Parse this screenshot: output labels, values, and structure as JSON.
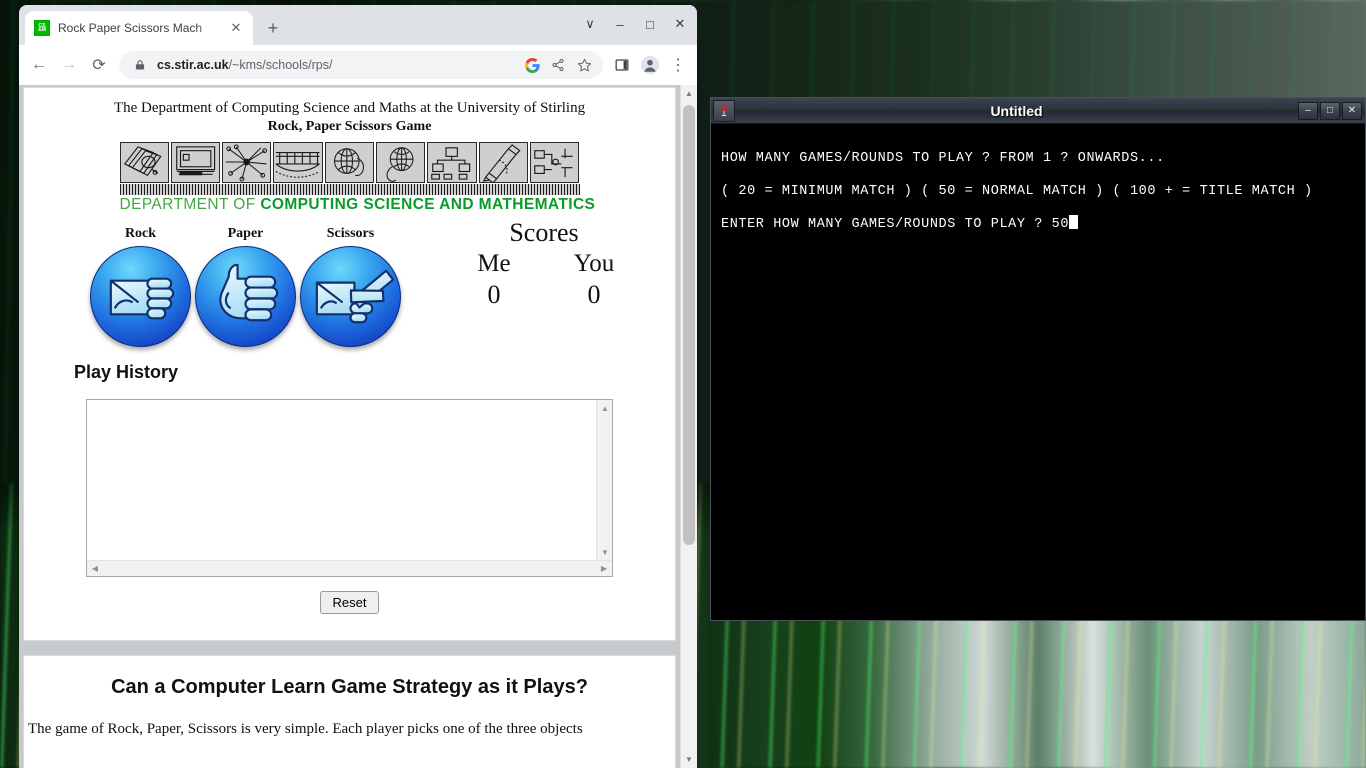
{
  "browser": {
    "tab": {
      "title": "Rock Paper Scissors Mach",
      "favicon_line1": "CS",
      "favicon_line2": "&M",
      "close_label": "✕",
      "favicon_icon": "cs-and-m-favicon"
    },
    "new_tab_label": "+",
    "window_controls": {
      "tab_search": "∨",
      "minimize": "–",
      "maximize": "□",
      "close": "✕"
    },
    "toolbar": {
      "back": "←",
      "forward": "→",
      "reload": "⟳",
      "lock_icon": "site-lock-icon",
      "url_domain": "cs.stir.ac.uk",
      "url_path": "/~kms/schools/rps/",
      "google_icon": "G",
      "share_icon": "share-icon",
      "bookmark_icon": "☆",
      "sidepanel_icon": "side-panel-icon",
      "profile_icon": "profile-avatar-icon",
      "menu_icon": "⋮"
    }
  },
  "page": {
    "university_line": "The Department of Computing Science and Maths at the University of Stirling",
    "game_title": "Rock, Paper Scissors Game",
    "dept_banner": {
      "prefix": "DEPARTMENT OF ",
      "emphasis": "COMPUTING SCIENCE AND MATHEMATICS",
      "tile_count": 9
    },
    "choices": [
      {
        "label": "Rock",
        "icon": "rock-hand-icon"
      },
      {
        "label": "Paper",
        "icon": "paper-hand-icon"
      },
      {
        "label": "Scissors",
        "icon": "scissors-hand-icon"
      }
    ],
    "scores": {
      "title": "Scores",
      "me_label": "Me",
      "you_label": "You",
      "me_value": "0",
      "you_value": "0"
    },
    "play_history_label": "Play History",
    "play_history_value": "",
    "play_history_placeholder": "",
    "reset_label": "Reset",
    "article": {
      "heading": "Can a Computer Learn Game Strategy as it Plays?",
      "paragraph": "The game of Rock, Paper, Scissors is very simple. Each player picks one of the three objects"
    },
    "scrollbar": {
      "up": "▲",
      "down": "▼"
    },
    "textarea_scroll": {
      "up": "▲",
      "down": "▼",
      "left": "◀",
      "right": "▶"
    }
  },
  "terminal": {
    "title": "Untitled",
    "icon": "wine-glass-icon",
    "buttons": {
      "minimize": "–",
      "maximize": "□",
      "close": "✕"
    },
    "lines": [
      "HOW MANY GAMES/ROUNDS TO PLAY ? FROM 1 ? ONWARDS...",
      "( 20 = MINIMUM MATCH ) ( 50 = NORMAL MATCH ) ( 100 + = TITLE MATCH )",
      "",
      "ENTER HOW MANY GAMES/ROUNDS TO PLAY ? 50"
    ],
    "input_prompt": "ENTER HOW MANY GAMES/ROUNDS TO PLAY ? ",
    "input_value": "50"
  },
  "colors": {
    "dept_green": "#3faa3f",
    "dept_green_bold": "#0a9c2a",
    "terminal_bg": "#000000",
    "terminal_fg": "#ffffff",
    "chrome_bg": "#dee1e6"
  }
}
